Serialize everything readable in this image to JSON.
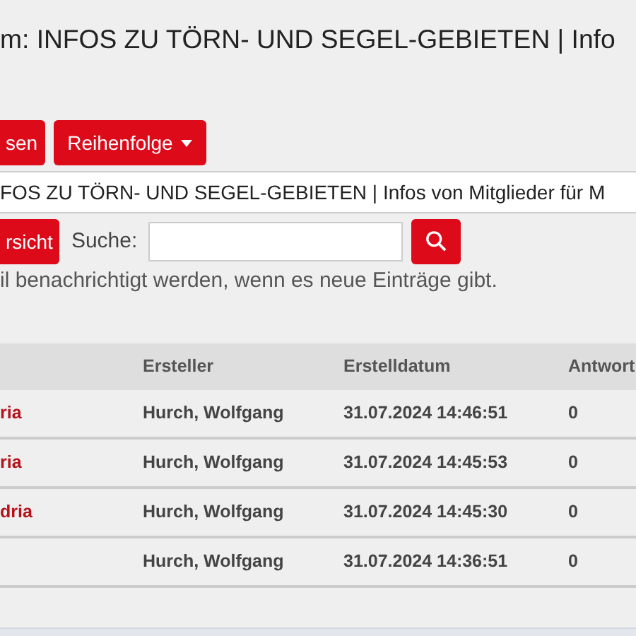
{
  "title": "m: INFOS ZU TÖRN- UND SEGEL-GEBIETEN | Info",
  "buttons": [
    {
      "label": "sen",
      "caret": false
    },
    {
      "label": "Reihenfolge",
      "caret": true
    }
  ],
  "breadcrumb": "FOS ZU TÖRN- UND SEGEL-GEBIETEN | Infos von Mitglieder für M",
  "overview_button": "rsicht",
  "search": {
    "label": "Suche:"
  },
  "notice": "il benachrichtigt werden, wenn es neue Einträge gibt.",
  "table": {
    "columns": [
      "Ersteller",
      "Erstelldatum",
      "Antwort"
    ],
    "rows": [
      {
        "topic": "ria",
        "author": "Hurch, Wolfgang",
        "date": "31.07.2024 14:46:51",
        "replies": "0"
      },
      {
        "topic": "ria",
        "author": "Hurch, Wolfgang",
        "date": "31.07.2024 14:45:53",
        "replies": "0"
      },
      {
        "topic": "dria",
        "author": "Hurch, Wolfgang",
        "date": "31.07.2024 14:45:30",
        "replies": "0"
      },
      {
        "author": "Hurch, Wolfgang",
        "date": "31.07.2024 14:36:51",
        "replies": "0"
      }
    ]
  }
}
